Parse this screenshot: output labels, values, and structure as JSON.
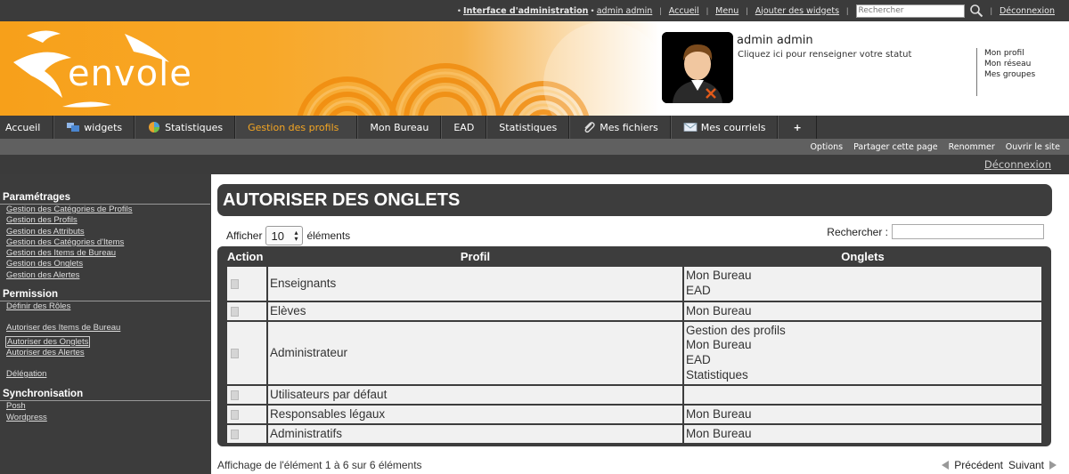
{
  "topbar": {
    "admin_interface": "Interface d'administration",
    "admin_user": "admin admin",
    "home": "Accueil",
    "menu": "Menu",
    "add_widgets": "Ajouter des widgets",
    "search_placeholder": "Rechercher",
    "logout": "Déconnexion"
  },
  "banner": {
    "logo_text": "envole",
    "user_name": "admin admin",
    "status_prompt": "Cliquez ici pour renseigner votre statut",
    "profile_links": [
      "Mon profil",
      "Mon réseau",
      "Mes groupes"
    ]
  },
  "nav": {
    "tabs": [
      {
        "label": "Accueil",
        "icon": ""
      },
      {
        "label": "widgets",
        "icon": "widgets-icon"
      },
      {
        "label": "Statistiques",
        "icon": "stats-icon"
      },
      {
        "label": "Gestion des profils",
        "icon": "",
        "active": true
      },
      {
        "label": "Mon Bureau",
        "icon": ""
      },
      {
        "label": "EAD",
        "icon": ""
      },
      {
        "label": "Statistiques",
        "icon": ""
      },
      {
        "label": "Mes fichiers",
        "icon": "paperclip-icon"
      },
      {
        "label": "Mes courriels",
        "icon": "mail-icon"
      },
      {
        "label": "+",
        "icon": ""
      }
    ]
  },
  "subnav": {
    "items": [
      "Options",
      "Partager cette page",
      "Renommer",
      "Ouvrir le site"
    ]
  },
  "logout_link": "Déconnexion",
  "sidebar": {
    "settings_title": "Paramétrages",
    "settings_items": [
      "Gestion des Catégories de Profils",
      "Gestion des Profils",
      "Gestion des Attributs",
      "Gestion des Catégories d'Items",
      "Gestion des Items de Bureau",
      "Gestion des Onglets",
      "Gestion des Alertes"
    ],
    "permission_title": "Permission",
    "roles": "Définir des Rôles",
    "auth_items": "Autoriser des Items de Bureau",
    "auth_tabs": "Autoriser des Onglets",
    "auth_alerts": "Autoriser des Alertes",
    "delegation": "Délégation",
    "sync_title": "Synchronisation",
    "sync_items": [
      "Posh",
      "Wordpress"
    ]
  },
  "main": {
    "title": "AUTORISER DES ONGLETS",
    "show_label": "Afficher",
    "page_length": "10",
    "entries_label": "éléments",
    "search_label": "Rechercher :",
    "columns": [
      "Action",
      "Profil",
      "Onglets"
    ],
    "rows": [
      {
        "profil": "Enseignants",
        "onglets": [
          "Mon Bureau",
          "EAD"
        ]
      },
      {
        "profil": "Elèves",
        "onglets": [
          "Mon Bureau"
        ]
      },
      {
        "profil": "Administrateur",
        "onglets": [
          "Gestion des profils",
          "Mon Bureau",
          "EAD",
          "Statistiques"
        ]
      },
      {
        "profil": "Utilisateurs par défaut",
        "onglets": []
      },
      {
        "profil": "Responsables légaux",
        "onglets": [
          "Mon Bureau"
        ]
      },
      {
        "profil": "Administratifs",
        "onglets": [
          "Mon Bureau"
        ]
      }
    ],
    "info": "Affichage de l'élément 1 à 6 sur 6 éléments",
    "prev": "Précédent",
    "next": "Suivant"
  }
}
